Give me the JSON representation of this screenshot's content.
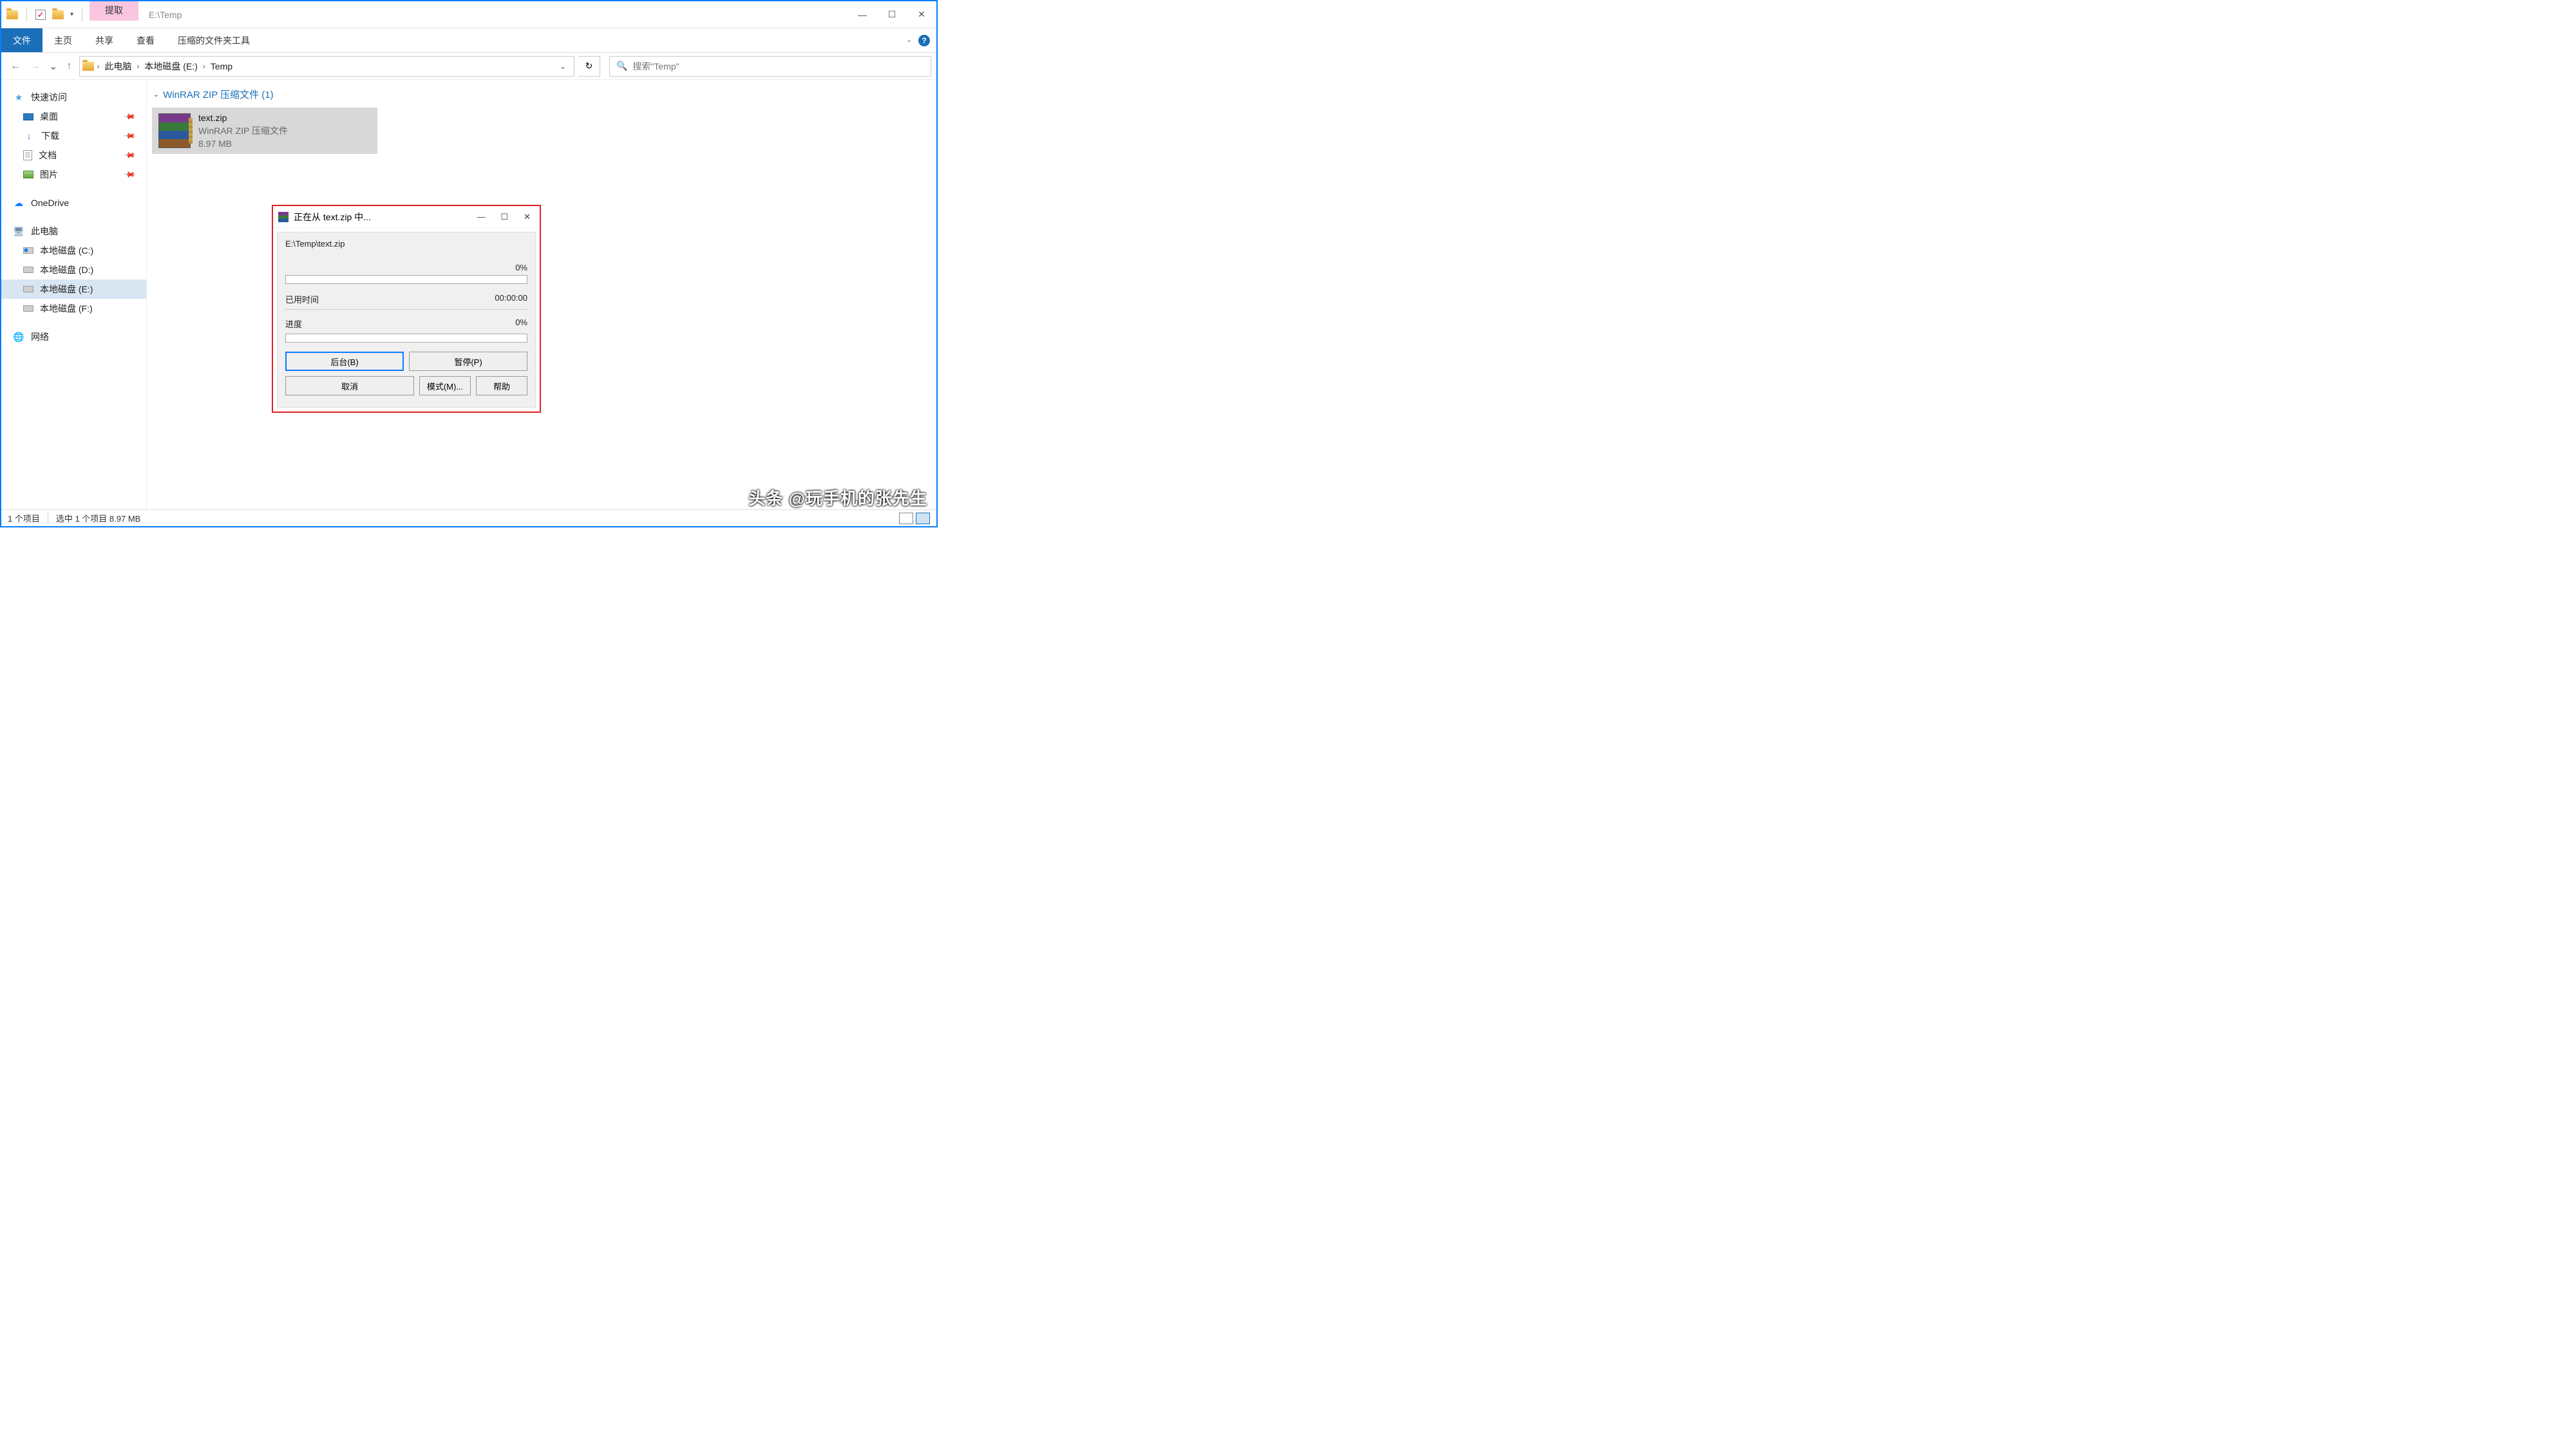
{
  "titlebar": {
    "contextual_tab": "提取",
    "title": "E:\\Temp"
  },
  "ribbon": {
    "file": "文件",
    "home": "主页",
    "share": "共享",
    "view": "查看",
    "contextual": "压缩的文件夹工具"
  },
  "breadcrumb": {
    "items": [
      "此电脑",
      "本地磁盘 (E:)",
      "Temp"
    ]
  },
  "search": {
    "placeholder": "搜索\"Temp\""
  },
  "sidebar": {
    "quick_access": "快速访问",
    "desktop": "桌面",
    "downloads": "下载",
    "documents": "文档",
    "pictures": "图片",
    "onedrive": "OneDrive",
    "this_pc": "此电脑",
    "drive_c": "本地磁盘 (C:)",
    "drive_d": "本地磁盘 (D:)",
    "drive_e": "本地磁盘 (E:)",
    "drive_f": "本地磁盘 (F:)",
    "network": "网络"
  },
  "content": {
    "group_header": "WinRAR ZIP 压缩文件 (1)",
    "file": {
      "name": "text.zip",
      "type": "WinRAR ZIP 压缩文件",
      "size": "8.97 MB"
    }
  },
  "dialog": {
    "title": "正在从 text.zip 中...",
    "path": "E:\\Temp\\text.zip",
    "progress1_pct": "0%",
    "elapsed_label": "已用时间",
    "elapsed_value": "00:00:00",
    "progress2_label": "进度",
    "progress2_pct": "0%",
    "btn_background": "后台(B)",
    "btn_pause": "暂停(P)",
    "btn_cancel": "取消",
    "btn_mode": "模式(M)...",
    "btn_help": "帮助"
  },
  "statusbar": {
    "items": "1 个项目",
    "selected": "选中 1 个项目  8.97 MB"
  },
  "watermark": "头条 @玩手机的张先生"
}
